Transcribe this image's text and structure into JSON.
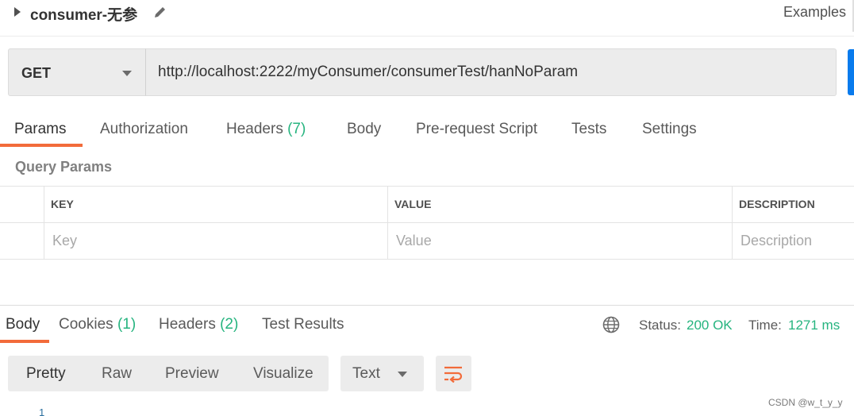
{
  "request": {
    "title": "consumer-无参",
    "examples_label": "Examples",
    "method": "GET",
    "url": "http://localhost:2222/myConsumer/consumerTest/hanNoParam"
  },
  "request_tabs": [
    {
      "label": "Params",
      "count": ""
    },
    {
      "label": "Authorization",
      "count": ""
    },
    {
      "label": "Headers",
      "count": "(7)"
    },
    {
      "label": "Body",
      "count": ""
    },
    {
      "label": "Pre-request Script",
      "count": ""
    },
    {
      "label": "Tests",
      "count": ""
    },
    {
      "label": "Settings",
      "count": ""
    }
  ],
  "query_params": {
    "label": "Query Params",
    "columns": [
      "KEY",
      "VALUE",
      "DESCRIPTION"
    ],
    "placeholders": [
      "Key",
      "Value",
      "Description"
    ]
  },
  "response": {
    "tabs": [
      {
        "label": "Body",
        "count": ""
      },
      {
        "label": "Cookies",
        "count": "(1)"
      },
      {
        "label": "Headers",
        "count": "(2)"
      },
      {
        "label": "Test Results",
        "count": ""
      }
    ],
    "status_label": "Status:",
    "status_value": "200 OK",
    "time_label": "Time:",
    "time_value": "1271 ms",
    "view_modes": [
      "Pretty",
      "Raw",
      "Preview",
      "Visualize"
    ],
    "format": "Text",
    "line_number": "1"
  },
  "watermark": "CSDN @w_t_y_y",
  "colors": {
    "accent_orange": "#f26b3a",
    "count_green": "#26b47f",
    "send_blue": "#097bed"
  }
}
